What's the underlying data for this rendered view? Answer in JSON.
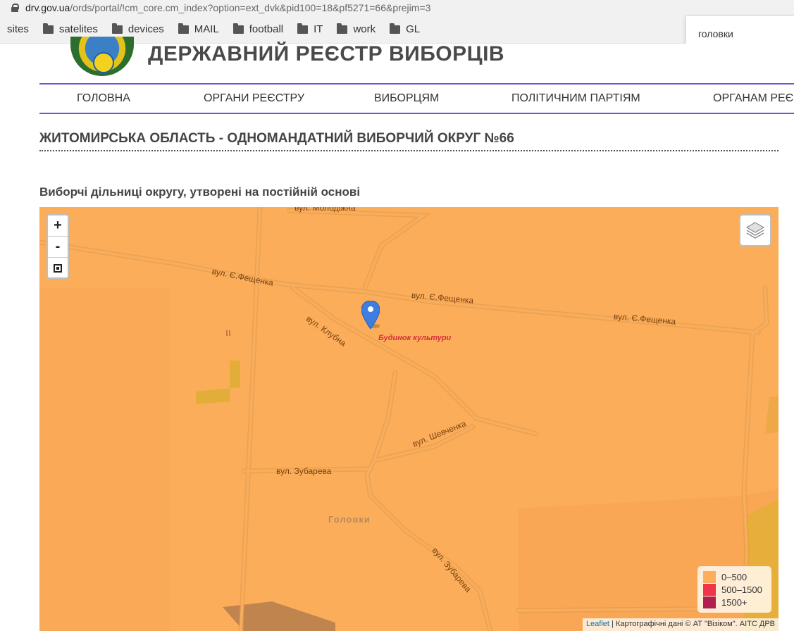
{
  "browser": {
    "url_domain": "drv.gov.ua",
    "url_path": "/ords/portal/!cm_core.cm_index?option=ext_dvk&pid100=18&pf5271=66&prejim=3",
    "bookmarks": [
      {
        "label": "sites",
        "folder": false
      },
      {
        "label": "satelites",
        "folder": true
      },
      {
        "label": "devices",
        "folder": true
      },
      {
        "label": "MAIL",
        "folder": true
      },
      {
        "label": "football",
        "folder": true
      },
      {
        "label": "IT",
        "folder": true
      },
      {
        "label": "work",
        "folder": true
      },
      {
        "label": "GL",
        "folder": true
      }
    ],
    "search_popup_text": "головки"
  },
  "site": {
    "title": "ДЕРЖАВНИЙ РЕЄСТР ВИБОРЦІВ",
    "nav": [
      "ГОЛОВНА",
      "ОРГАНИ РЕЄСТРУ",
      "ВИБОРЦЯМ",
      "ПОЛІТИЧНИМ ПАРТІЯМ",
      "ОРГАНАМ РЕЄС"
    ]
  },
  "main": {
    "section_title": "ЖИТОМИРСЬКА ОБЛАСТЬ - ОДНОМАНДАТНИЙ ВИБОРЧИЙ ОКРУГ №66",
    "subtitle": "Виборчі дільниці округу, утворені на постійній основі"
  },
  "map": {
    "zoom_in": "+",
    "zoom_out": "-",
    "streets": {
      "molodizhna": "вул. Молодіжна",
      "feshchenka1": "вул. Є.Фещенка",
      "feshchenka2": "вул. Є.Фещенка",
      "feshchenka3": "вул. Є.Фещенка",
      "klubna": "вул. Клубна",
      "shevchenka": "вул. Шевченка",
      "zubareva1": "вул. Зубарева",
      "zubareva2": "вул. Зубарева"
    },
    "poi": "Будинок культури",
    "place": "Головки",
    "legend": [
      {
        "label": "0–500",
        "color": "#fcae5b"
      },
      {
        "label": "500–1500",
        "color": "#f0344a"
      },
      {
        "label": "1500+",
        "color": "#b21f4e"
      }
    ],
    "attribution_link": "Leaflet",
    "attribution_text": " | Картографічні дані © АТ \"Візіком\". АІТС ДРВ",
    "colors": {
      "fill": "#fcad5a",
      "road": "#f0a24e",
      "road_edge": "#e39345"
    }
  }
}
